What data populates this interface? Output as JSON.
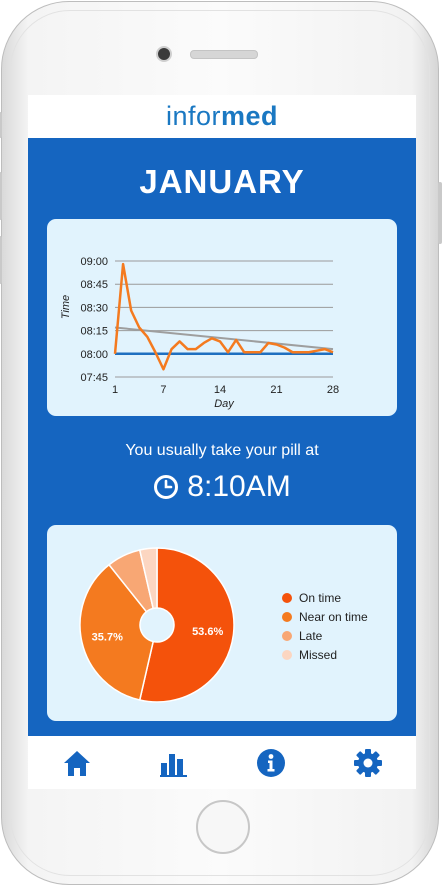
{
  "app": {
    "logo_light": "infor",
    "logo_bold": "med"
  },
  "header": {
    "month": "JANUARY"
  },
  "summary": {
    "text": "You usually take your pill at",
    "time": "8:10AM"
  },
  "colors": {
    "brand_blue": "#1565c0",
    "card_bg": "#e1f3fd",
    "line_orange": "#f47a1f",
    "trend_gray": "#9e9e9e",
    "baseline_blue": "#1e6fc0"
  },
  "chart_data": [
    {
      "type": "line",
      "xlabel": "Day",
      "ylabel": "Time",
      "xticks": [
        "1",
        "7",
        "14",
        "21",
        "28"
      ],
      "yticks": [
        "09:00",
        "08:45",
        "08:30",
        "08:15",
        "08:00",
        "07:45"
      ],
      "xlim": [
        1,
        28
      ],
      "ylim_minutes": [
        465,
        540
      ],
      "grid": true,
      "series": [
        {
          "role": "actual",
          "x": [
            1,
            2,
            3,
            4,
            5,
            6,
            7,
            8,
            9,
            10,
            11,
            12,
            13,
            14,
            15,
            16,
            17,
            18,
            19,
            20,
            21,
            22,
            23,
            24,
            25,
            26,
            27,
            28
          ],
          "y_minutes": [
            480,
            538,
            508,
            497,
            491,
            481,
            470,
            483,
            488,
            483,
            483,
            487,
            490,
            488,
            481,
            489,
            481,
            481,
            481,
            487,
            486,
            484,
            481,
            481,
            481,
            482,
            483,
            481
          ]
        },
        {
          "role": "trend",
          "x": [
            1,
            28
          ],
          "y_minutes": [
            497,
            483
          ]
        },
        {
          "role": "baseline",
          "x": [
            1,
            28
          ],
          "y_minutes": [
            480,
            480
          ]
        }
      ]
    },
    {
      "type": "pie",
      "slices": [
        {
          "label": "On time",
          "value": 53.6,
          "color": "#f4520b",
          "shown": "53.6%"
        },
        {
          "label": "Near on time",
          "value": 35.7,
          "color": "#f47a1f",
          "shown": "35.7%"
        },
        {
          "label": "Late",
          "value": 7.1,
          "color": "#f8a774",
          "shown": ""
        },
        {
          "label": "Missed",
          "value": 3.6,
          "color": "#fcd6c1",
          "shown": ""
        }
      ],
      "legend": "right"
    }
  ],
  "tabs": [
    {
      "icon": "home-icon"
    },
    {
      "icon": "bar-chart-icon"
    },
    {
      "icon": "info-icon"
    },
    {
      "icon": "gear-icon"
    }
  ]
}
